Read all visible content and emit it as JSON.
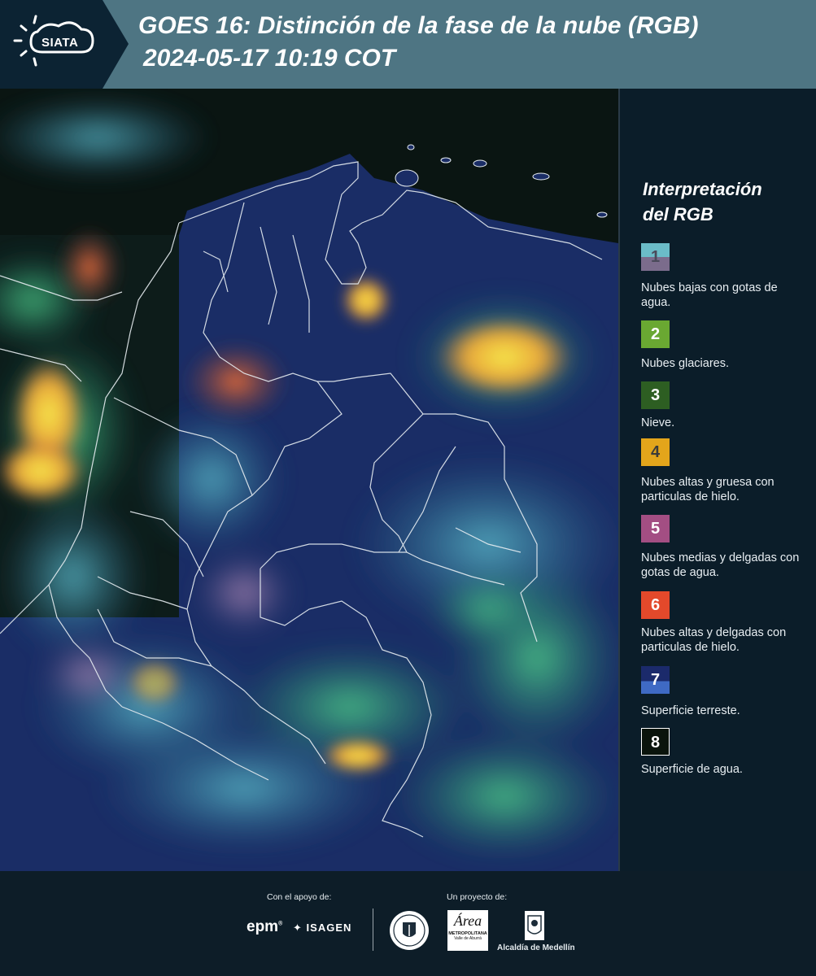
{
  "header": {
    "logo_text": "SIATA",
    "title": "GOES 16: Distinción de la fase de la nube (RGB)",
    "subtitle": "2024-05-17 10:19 COT"
  },
  "legend": {
    "title_line1": "Interpretación",
    "title_line2": "del RGB",
    "items": [
      {
        "number": "1",
        "label": "Nubes bajas con gotas de agua.",
        "color_top": "#6bbcc8",
        "color_bottom": "#7b6c8c"
      },
      {
        "number": "2",
        "label": "Nubes glaciares.",
        "color_top": "#6aa832",
        "color_bottom": "#6aa832"
      },
      {
        "number": "3",
        "label": "Nieve.",
        "color_top": "#2d5e22",
        "color_bottom": "#2d5e22"
      },
      {
        "number": "4",
        "label": "Nubes altas y gruesa con particulas de hielo.",
        "color_top": "#e3a51b",
        "color_bottom": "#e3a51b"
      },
      {
        "number": "5",
        "label": "Nubes medias y delgadas con gotas de agua.",
        "color_top": "#a34e83",
        "color_bottom": "#a34e83"
      },
      {
        "number": "6",
        "label": "Nubes altas y delgadas con particulas de hielo.",
        "color_top": "#e3492b",
        "color_bottom": "#e3492b"
      },
      {
        "number": "7",
        "label": "Superficie terreste.",
        "color_top": "#1b2a6b",
        "color_bottom": "#3f6ac4"
      },
      {
        "number": "8",
        "label": "Superficie de agua.",
        "color_top": "#0a140c",
        "color_bottom": "#0a140c"
      }
    ]
  },
  "footer": {
    "support_label": "Con el apoyo de:",
    "project_label": "Un proyecto de:",
    "epm": "epm",
    "isagen": "ISAGEN",
    "area_metro": "Área",
    "area_metro_sub": "METROPOLITANA",
    "area_metro_sub2": "Valle de Aburrá",
    "alcaldia": "Alcaldía de Medellín"
  },
  "colors": {
    "header_bg": "#4e7583",
    "page_bg": "#0b1d29",
    "accent_land": "#1b2a6b"
  }
}
